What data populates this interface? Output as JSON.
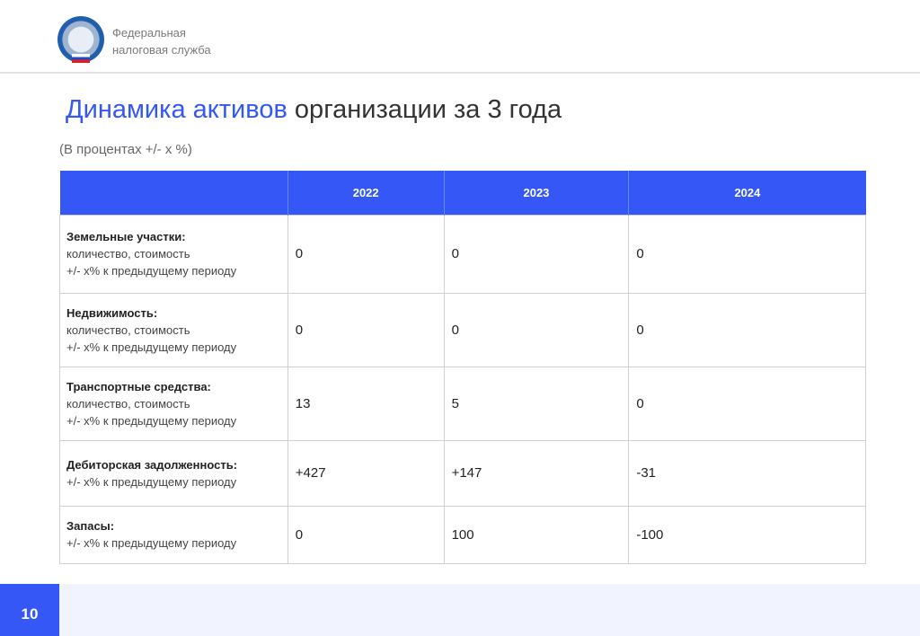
{
  "header": {
    "org_line1": "Федеральная",
    "org_line2": "налоговая служба"
  },
  "title": {
    "highlight": "Динамика активов",
    "rest": " организации за 3 года"
  },
  "subtitle": "(В процентах +/- х %)",
  "table": {
    "columns": [
      "",
      "2022",
      "2023",
      "2024"
    ],
    "rows": [
      {
        "name": "Земельные участки:",
        "desc1": "количество, стоимость",
        "desc2": "+/- х% к предыдущему периоду",
        "values": [
          "0",
          "0",
          "0"
        ]
      },
      {
        "name": "Недвижимость:",
        "desc1": "количество, стоимость",
        "desc2": "+/- х% к предыдущему периоду",
        "values": [
          "0",
          "0",
          "0"
        ]
      },
      {
        "name": "Транспортные средства:",
        "desc1": "количество, стоимость",
        "desc2": "+/- х% к предыдущему периоду",
        "values": [
          "13",
          "5",
          "0"
        ]
      },
      {
        "name": "Дебиторская задолженность:",
        "desc1": "+/- х% к предыдущему периоду",
        "values": [
          "+427",
          "+147",
          "-31"
        ]
      },
      {
        "name": "Запасы:",
        "desc1": "+/- х% к предыдущему периоду",
        "values": [
          "0",
          "100",
          "-100"
        ]
      }
    ]
  },
  "page_number": "10"
}
